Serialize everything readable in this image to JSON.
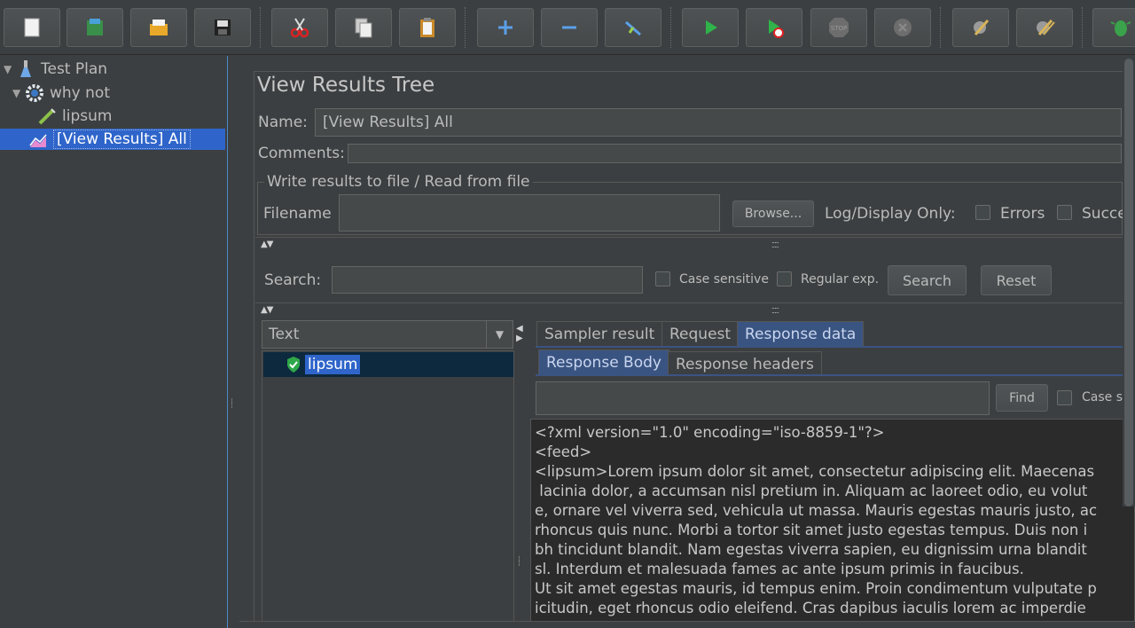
{
  "toolbar": {
    "buttons": [
      {
        "name": "new-icon"
      },
      {
        "name": "templates-icon"
      },
      {
        "name": "open-icon"
      },
      {
        "name": "save-icon"
      },
      {
        "name": "cut-icon"
      },
      {
        "name": "copy-icon"
      },
      {
        "name": "paste-icon"
      },
      {
        "name": "expand-icon"
      },
      {
        "name": "collapse-icon"
      },
      {
        "name": "toggle-icon"
      },
      {
        "name": "start-icon"
      },
      {
        "name": "start-no-pauses-icon"
      },
      {
        "name": "stop-icon"
      },
      {
        "name": "shutdown-icon"
      },
      {
        "name": "clear-icon"
      },
      {
        "name": "clear-all-icon"
      },
      {
        "name": "search-bug-icon"
      }
    ],
    "stop_text": "STOP"
  },
  "tree": {
    "items": [
      {
        "label": "Test Plan",
        "icon": "flask-icon"
      },
      {
        "label": "why not",
        "icon": "gear-icon"
      },
      {
        "label": "lipsum",
        "icon": "pipette-icon"
      },
      {
        "label": "[View Results] All",
        "icon": "chart-icon"
      }
    ]
  },
  "panel": {
    "title": "View Results Tree",
    "name_label": "Name:",
    "name_value": "[View Results] All",
    "comments_label": "Comments:",
    "file_group_label": "Write results to file / Read from file",
    "filename_label": "Filename",
    "browse_label": "Browse...",
    "log_display_label": "Log/Display Only:",
    "errors_label": "Errors",
    "success_label": "Succe"
  },
  "search": {
    "label": "Search:",
    "case_sensitive_label": "Case sensitive",
    "regex_label": "Regular exp.",
    "search_button": "Search",
    "reset_button": "Reset"
  },
  "results": {
    "renderer": "Text",
    "items": [
      {
        "label": "lipsum",
        "status": "success"
      }
    ]
  },
  "tabs": {
    "main": [
      "Sampler result",
      "Request",
      "Response data"
    ],
    "sub": [
      "Response Body",
      "Response headers"
    ]
  },
  "find": {
    "find_button": "Find",
    "case_label": "Case s"
  },
  "response_lines": [
    "<?xml version=\"1.0\" encoding=\"iso-8859-1\"?>",
    "<feed>",
    "<lipsum>Lorem ipsum dolor sit amet, consectetur adipiscing elit. Maecenas",
    " lacinia dolor, a accumsan nisl pretium in. Aliquam ac laoreet odio, eu volut",
    "e, ornare vel viverra sed, vehicula ut massa. Mauris egestas mauris justo, ac",
    "rhoncus quis nunc. Morbi a tortor sit amet justo egestas tempus. Duis non i",
    "bh tincidunt blandit. Nam egestas viverra sapien, eu dignissim urna blandit",
    "sl. Interdum et malesuada fames ac ante ipsum primis in faucibus.",
    "Ut sit amet egestas mauris, id tempus enim. Proin condimentum vulputate p",
    "icitudin, eget rhoncus odio eleifend. Cras dapibus iaculis lorem ac imperdie"
  ],
  "colors": {
    "background": "#3c3f41",
    "selection": "#2f65ca",
    "active_tab": "#3a5482",
    "text_area": "#2b2b2b"
  }
}
